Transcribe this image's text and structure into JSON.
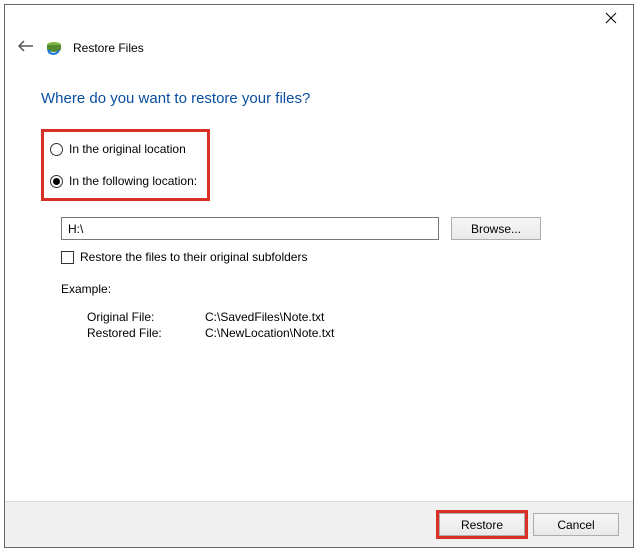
{
  "window": {
    "title": "Restore Files"
  },
  "heading": "Where do you want to restore your files?",
  "options": {
    "original": "In the original location",
    "following": "In the following location:"
  },
  "path": {
    "value": "H:\\",
    "browse": "Browse..."
  },
  "subfolders_label": "Restore the files to their original subfolders",
  "example": {
    "label": "Example:",
    "orig_key": "Original File:",
    "orig_val": "C:\\SavedFiles\\Note.txt",
    "rest_key": "Restored File:",
    "rest_val": "C:\\NewLocation\\Note.txt"
  },
  "buttons": {
    "restore": "Restore",
    "cancel": "Cancel"
  }
}
